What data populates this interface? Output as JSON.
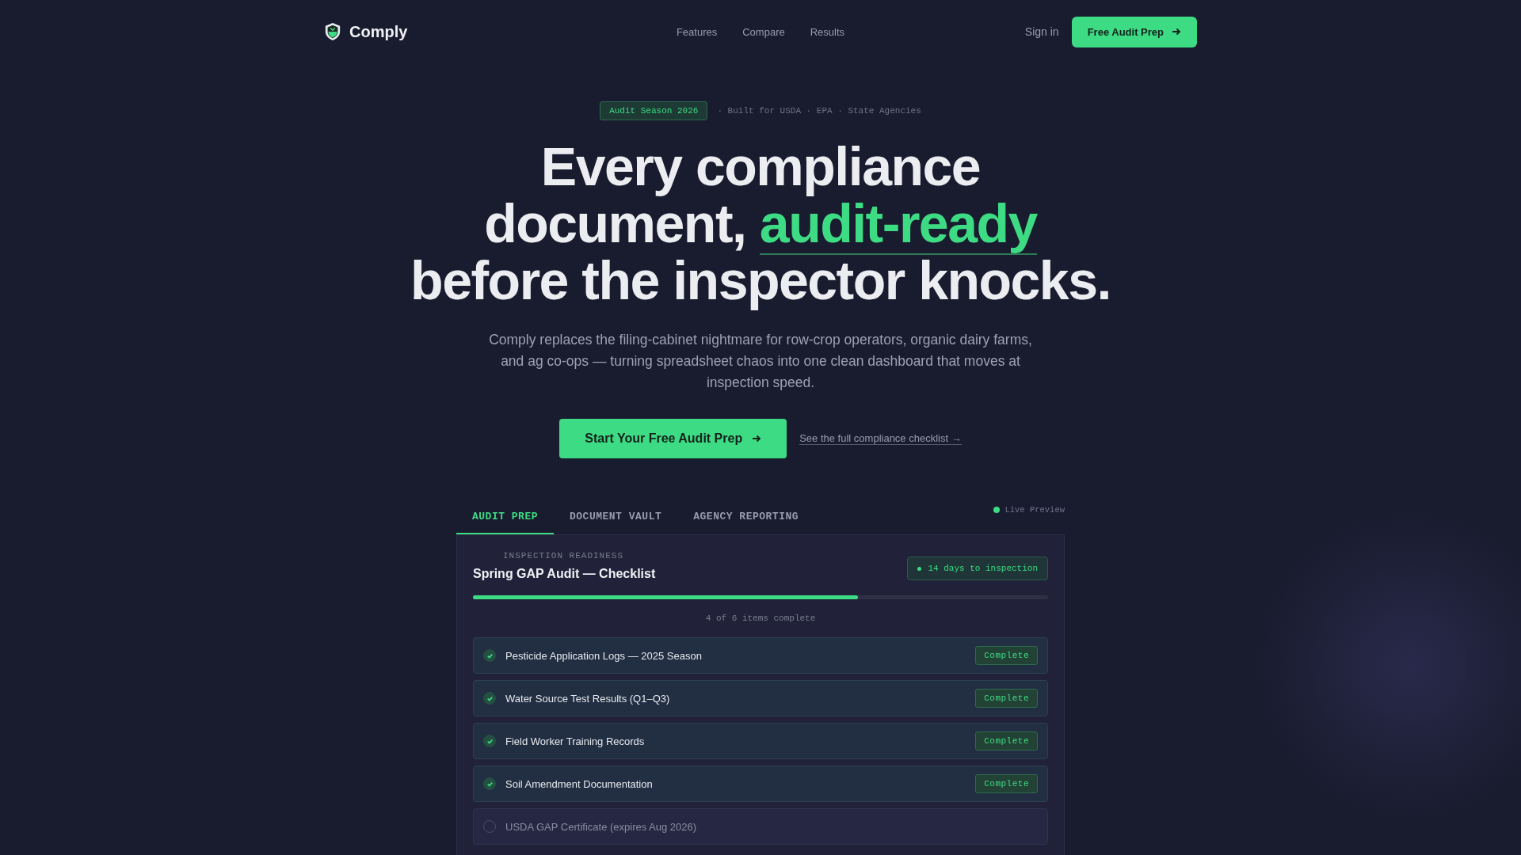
{
  "nav": {
    "brand": "Comply",
    "links": [
      "Features",
      "Compare",
      "Results"
    ],
    "sign_in": "Sign in",
    "cta": "Free Audit Prep"
  },
  "hero": {
    "badge": "Audit Season 2026",
    "tagline": "· Built for USDA · EPA · State Agencies",
    "headline_before": "Every compliance document,",
    "headline_highlight": "audit-ready",
    "headline_after": "before the inspector knocks.",
    "subtitle": "Comply replaces the filing-cabinet nightmare for row-crop operators, organic dairy farms, and ag co-ops — turning spreadsheet chaos into one clean dashboard that moves at inspection speed.",
    "primary_cta": "Start Your Free Audit Prep",
    "secondary_link": "See the full compliance checklist →"
  },
  "tabs": [
    {
      "label": "AUDIT PREP",
      "selected": true
    },
    {
      "label": "DOCUMENT VAULT",
      "selected": false
    },
    {
      "label": "AGENCY REPORTING",
      "selected": false
    }
  ],
  "live_preview": "Live Preview",
  "card": {
    "eyebrow": "INSPECTION READINESS",
    "title": "Spring GAP Audit — Checklist",
    "countdown": "14 days to inspection",
    "progress": {
      "level": 0.67
    },
    "progress_text": "4 of 6 items complete",
    "items": [
      {
        "label": "Pesticide Application Logs — 2025 Season",
        "checked": true,
        "status": "Complete"
      },
      {
        "label": "Water Source Test Results (Q1–Q3)",
        "checked": true,
        "status": "Complete"
      },
      {
        "label": "Field Worker Training Records",
        "checked": true,
        "status": "Complete"
      },
      {
        "label": "Soil Amendment Documentation",
        "checked": true,
        "status": "Complete"
      },
      {
        "label": "USDA GAP Certificate (expires Aug 2026)",
        "checked": false
      }
    ]
  }
}
